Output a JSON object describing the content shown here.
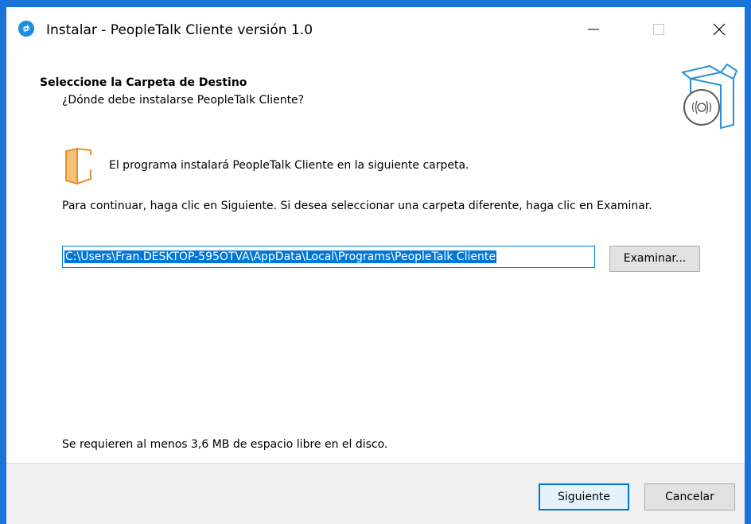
{
  "window": {
    "title": "Instalar - PeopleTalk Cliente versión 1.0"
  },
  "header": {
    "title": "Seleccione la Carpeta de Destino",
    "subtitle": "¿Dónde debe instalarse PeopleTalk Cliente?"
  },
  "body": {
    "folder_message": "El programa instalará PeopleTalk Cliente en la siguiente carpeta.",
    "instructions": "Para continuar, haga clic en Siguiente. Si desea seleccionar una carpeta diferente, haga clic en Examinar.",
    "path_value": "C:\\Users\\Fran.DESKTOP-595OTVA\\AppData\\Local\\Programs\\PeopleTalk Cliente",
    "browse_label": "Examinar...",
    "disk_space": "Se requieren al menos 3,6 MB de espacio libre en el disco."
  },
  "footer": {
    "next_label": "Siguiente",
    "cancel_label": "Cancelar"
  },
  "colors": {
    "accent": "#0078d7",
    "window_border": "#1a73d9",
    "footer_bg": "#f0f0f0",
    "folder_icon": "#f0a040"
  },
  "icons": [
    "app-logo-icon",
    "minimize-icon",
    "maximize-icon",
    "close-icon",
    "install-box-icon",
    "folder-icon"
  ]
}
